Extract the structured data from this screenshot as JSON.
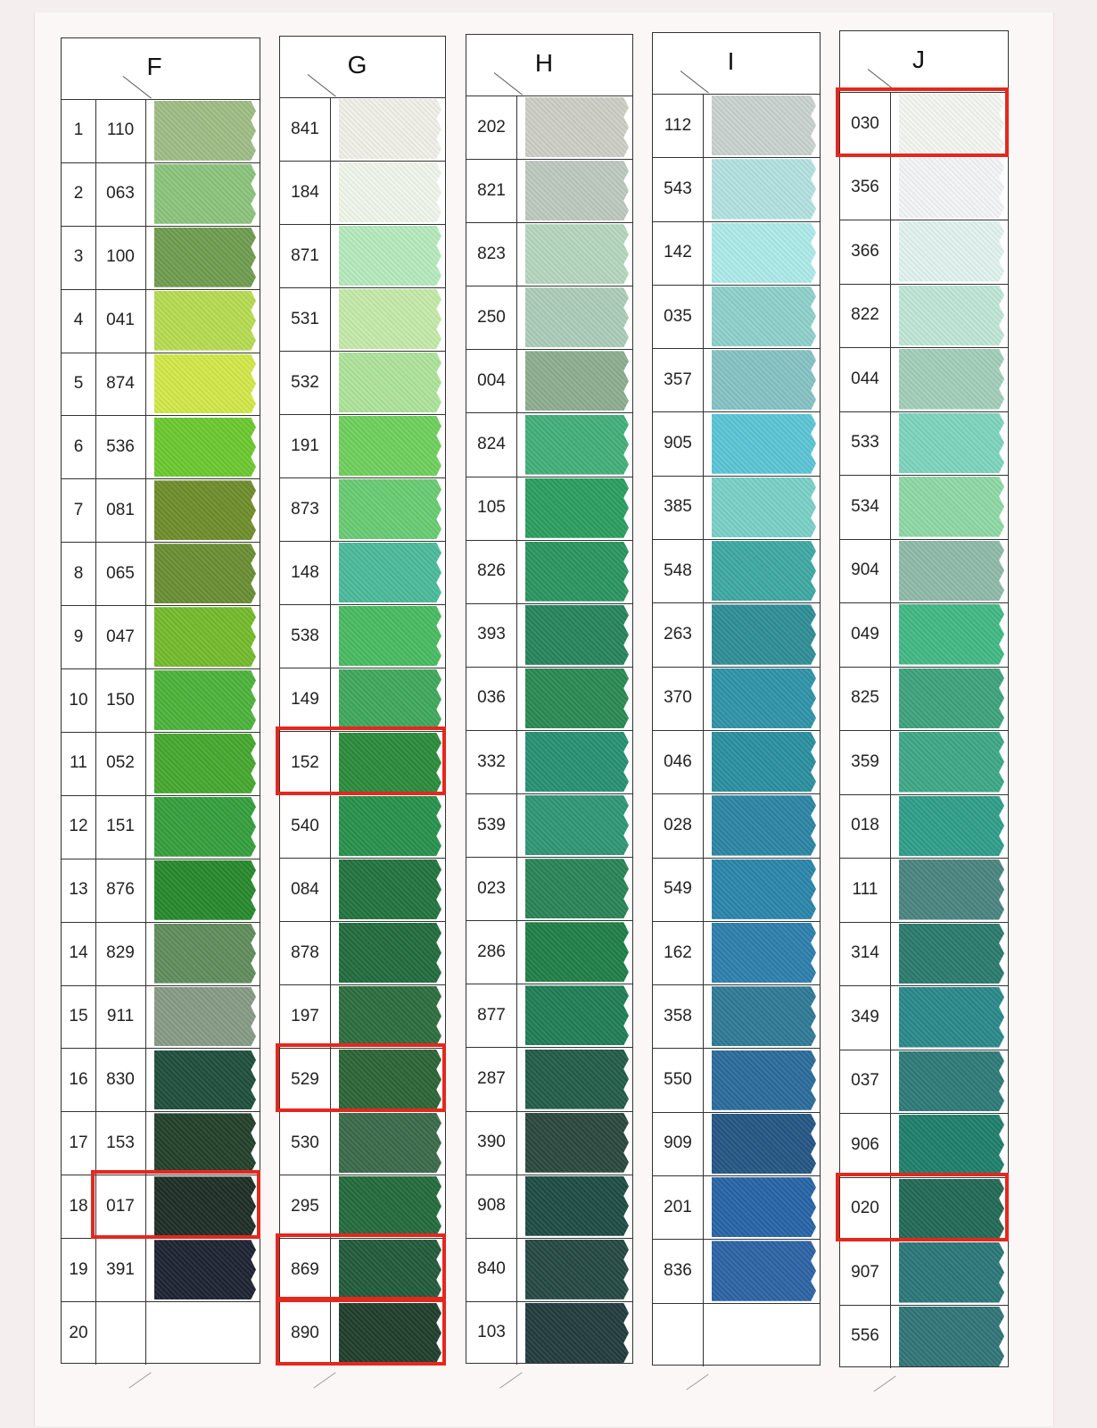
{
  "columns": [
    {
      "letter": "F",
      "has_index": true,
      "rows": [
        {
          "n": "1",
          "code": "110",
          "color": "#9fbe86"
        },
        {
          "n": "2",
          "code": "063",
          "color": "#8cc47c"
        },
        {
          "n": "3",
          "code": "100",
          "color": "#6f9d4e"
        },
        {
          "n": "4",
          "code": "041",
          "color": "#b6dc52"
        },
        {
          "n": "5",
          "code": "874",
          "color": "#d3e84a"
        },
        {
          "n": "6",
          "code": "536",
          "color": "#6cc92e"
        },
        {
          "n": "7",
          "code": "081",
          "color": "#6f8d2a"
        },
        {
          "n": "8",
          "code": "065",
          "color": "#6a8e32"
        },
        {
          "n": "9",
          "code": "047",
          "color": "#74bb2b"
        },
        {
          "n": "10",
          "code": "150",
          "color": "#4bb33a"
        },
        {
          "n": "11",
          "code": "052",
          "color": "#46a82e"
        },
        {
          "n": "12",
          "code": "151",
          "color": "#34a03c"
        },
        {
          "n": "13",
          "code": "876",
          "color": "#268a2c"
        },
        {
          "n": "14",
          "code": "829",
          "color": "#5f8d5d"
        },
        {
          "n": "15",
          "code": "911",
          "color": "#879b85"
        },
        {
          "n": "16",
          "code": "830",
          "color": "#1f4f3c"
        },
        {
          "n": "17",
          "code": "153",
          "color": "#23402a"
        },
        {
          "n": "18",
          "code": "017",
          "color": "#1e2e27"
        },
        {
          "n": "19",
          "code": "391",
          "color": "#1d2333"
        },
        {
          "n": "20",
          "code": "",
          "color": ""
        }
      ]
    },
    {
      "letter": "G",
      "has_index": false,
      "rows": [
        {
          "code": "841",
          "color": "#f1f0e8"
        },
        {
          "code": "184",
          "color": "#f0f6ea"
        },
        {
          "code": "871",
          "color": "#b6ebbd"
        },
        {
          "code": "531",
          "color": "#c4eba9"
        },
        {
          "code": "532",
          "color": "#aee49a"
        },
        {
          "code": "191",
          "color": "#6fd05d"
        },
        {
          "code": "873",
          "color": "#68cc72"
        },
        {
          "code": "148",
          "color": "#4bbb9b"
        },
        {
          "code": "538",
          "color": "#49bb62"
        },
        {
          "code": "149",
          "color": "#3fa85b"
        },
        {
          "code": "152",
          "color": "#2a8c3b"
        },
        {
          "code": "540",
          "color": "#27914c"
        },
        {
          "code": "084",
          "color": "#22743e"
        },
        {
          "code": "878",
          "color": "#226c3e"
        },
        {
          "code": "197",
          "color": "#2c6e3e"
        },
        {
          "code": "529",
          "color": "#2b6535"
        },
        {
          "code": "530",
          "color": "#3b6a4a"
        },
        {
          "code": "295",
          "color": "#236b3c"
        },
        {
          "code": "869",
          "color": "#225b3b"
        },
        {
          "code": "890",
          "color": "#1f3e2c"
        }
      ]
    },
    {
      "letter": "H",
      "has_index": false,
      "rows": [
        {
          "code": "202",
          "color": "#cdcfc5"
        },
        {
          "code": "821",
          "color": "#bdc9bf"
        },
        {
          "code": "823",
          "color": "#b5d7be"
        },
        {
          "code": "250",
          "color": "#abcdb9"
        },
        {
          "code": "004",
          "color": "#8dae90"
        },
        {
          "code": "824",
          "color": "#41b07a"
        },
        {
          "code": "105",
          "color": "#2b9e60"
        },
        {
          "code": "826",
          "color": "#2a9560"
        },
        {
          "code": "393",
          "color": "#27845d"
        },
        {
          "code": "036",
          "color": "#2a8a52"
        },
        {
          "code": "332",
          "color": "#279073"
        },
        {
          "code": "539",
          "color": "#2f9676"
        },
        {
          "code": "023",
          "color": "#2a8456"
        },
        {
          "code": "286",
          "color": "#1f7f47"
        },
        {
          "code": "877",
          "color": "#1f7e55"
        },
        {
          "code": "287",
          "color": "#235c49"
        },
        {
          "code": "390",
          "color": "#2a483e"
        },
        {
          "code": "908",
          "color": "#1e4c46"
        },
        {
          "code": "840",
          "color": "#254943"
        },
        {
          "code": "103",
          "color": "#233c3e"
        }
      ]
    },
    {
      "letter": "I",
      "has_index": false,
      "rows": [
        {
          "code": "112",
          "color": "#c9d3cf"
        },
        {
          "code": "543",
          "color": "#b4e2e2"
        },
        {
          "code": "142",
          "color": "#aeeaea"
        },
        {
          "code": "035",
          "color": "#8fd1cc"
        },
        {
          "code": "357",
          "color": "#86c3c4"
        },
        {
          "code": "905",
          "color": "#5bc5d6"
        },
        {
          "code": "385",
          "color": "#7ad1c8"
        },
        {
          "code": "548",
          "color": "#3ea9a3"
        },
        {
          "code": "263",
          "color": "#2f8e96"
        },
        {
          "code": "370",
          "color": "#2f94a9"
        },
        {
          "code": "046",
          "color": "#2a8fa0"
        },
        {
          "code": "028",
          "color": "#2b86a4"
        },
        {
          "code": "549",
          "color": "#2a86ab"
        },
        {
          "code": "162",
          "color": "#2d7fae"
        },
        {
          "code": "358",
          "color": "#2f7a96"
        },
        {
          "code": "550",
          "color": "#2a6c9b"
        },
        {
          "code": "909",
          "color": "#245685"
        },
        {
          "code": "201",
          "color": "#2764a6"
        },
        {
          "code": "836",
          "color": "#2c63a5"
        },
        {
          "code": "",
          "color": ""
        }
      ]
    },
    {
      "letter": "J",
      "has_index": false,
      "rows": [
        {
          "code": "030",
          "color": "#f3f6f1"
        },
        {
          "code": "356",
          "color": "#f3f5f6"
        },
        {
          "code": "366",
          "color": "#e2f3ef"
        },
        {
          "code": "822",
          "color": "#bfe7d7"
        },
        {
          "code": "044",
          "color": "#a2cfb8"
        },
        {
          "code": "533",
          "color": "#7dd5bd"
        },
        {
          "code": "534",
          "color": "#8ed9a6"
        },
        {
          "code": "904",
          "color": "#8fbaa9"
        },
        {
          "code": "049",
          "color": "#41b985"
        },
        {
          "code": "825",
          "color": "#3ea37d"
        },
        {
          "code": "359",
          "color": "#3da887"
        },
        {
          "code": "018",
          "color": "#2f9e8a"
        },
        {
          "code": "111",
          "color": "#4a8580"
        },
        {
          "code": "314",
          "color": "#2a7b6e"
        },
        {
          "code": "349",
          "color": "#29898a"
        },
        {
          "code": "037",
          "color": "#2d7b78"
        },
        {
          "code": "906",
          "color": "#1e7f6b"
        },
        {
          "code": "020",
          "color": "#226955"
        },
        {
          "code": "907",
          "color": "#2b7778"
        },
        {
          "code": "556",
          "color": "#307577"
        }
      ]
    }
  ],
  "highlighted_codes": [
    "017",
    "152",
    "529",
    "869",
    "890",
    "030",
    "020"
  ]
}
